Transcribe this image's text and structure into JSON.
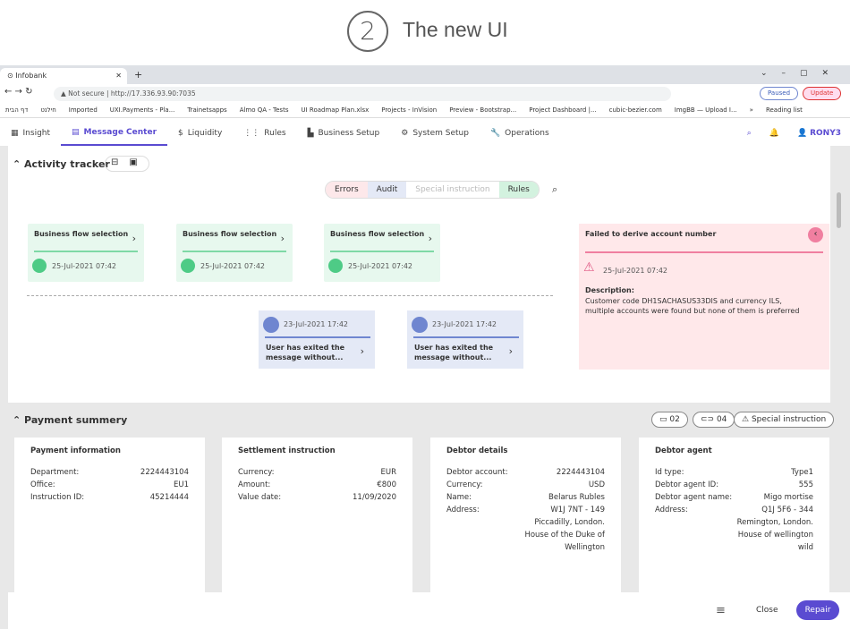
{
  "header": {
    "step": "2",
    "title": "The new UI"
  },
  "browser": {
    "tab_title": "Infobank",
    "security": "Not secure",
    "url": "http://17.336.93.90:7035",
    "paused": "Paused",
    "update": "Update",
    "bookmarks": [
      "דף הבית",
      "חילנט",
      "Imported",
      "UXI.Payments - Pla...",
      "Trainetsapps",
      "Almo QA - Tests",
      "UI Roadmap Plan.xlsx",
      "Projects - InVision",
      "Preview - Bootstrap...",
      "Project Dashboard |...",
      "cubic-bezier.com",
      "ImgBB — Upload I...",
      "»",
      "Reading list"
    ]
  },
  "nav": {
    "items": [
      "Insight",
      "Message Center",
      "Liquidity",
      "Rules",
      "Business Setup",
      "System Setup",
      "Operations"
    ],
    "active": "Message Center",
    "user": "RONY3"
  },
  "activity": {
    "title": "Activity tracker",
    "filters": [
      "Errors",
      "Audit",
      "Special instruction",
      "Rules"
    ],
    "flow_cards": [
      {
        "title": "Business flow selection",
        "date": "25-Jul-2021 07:42"
      },
      {
        "title": "Business flow selection",
        "date": "25-Jul-2021 07:42"
      },
      {
        "title": "Business flow selection",
        "date": "25-Jul-2021 07:42"
      }
    ],
    "audit_cards": [
      {
        "date": "23-Jul-2021 17:42",
        "title": "User has exited the message without..."
      },
      {
        "date": "23-Jul-2021 17:42",
        "title": "User has exited the message without..."
      }
    ],
    "error": {
      "title": "Failed to derive account number",
      "date": "25-Jul-2021 07:42",
      "desc_label": "Description:",
      "desc": "Customer code DH1SACHASUS33DIS and currency ILS, multiple accounts were found but none of them is preferred"
    }
  },
  "payment": {
    "title": "Payment summery",
    "comments": "02",
    "attachments": "04",
    "special": "Special instruction",
    "cards": [
      {
        "title": "Payment  information",
        "rows": [
          [
            "Department:",
            "2224443104"
          ],
          [
            "Office:",
            "EU1"
          ],
          [
            "Instruction ID:",
            "45214444"
          ]
        ]
      },
      {
        "title": "Settlement instruction",
        "rows": [
          [
            "Currency:",
            "EUR"
          ],
          [
            "Amount:",
            "€800"
          ],
          [
            "Value date:",
            "11/09/2020"
          ]
        ]
      },
      {
        "title": "Debtor details",
        "rows": [
          [
            "Debtor account:",
            "2224443104"
          ],
          [
            "Currency:",
            "USD"
          ],
          [
            "Name:",
            "Belarus Rubles"
          ],
          [
            "Address:",
            "W1J 7NT - 149"
          ],
          [
            "",
            "Piccadilly, London."
          ],
          [
            "",
            "House of the Duke of"
          ],
          [
            "",
            "Wellington"
          ]
        ]
      },
      {
        "title": "Debtor agent",
        "rows": [
          [
            "Id type:",
            "Type1"
          ],
          [
            "Debtor agent ID:",
            "555"
          ],
          [
            "Debtor agent name:",
            "Migo mortise"
          ],
          [
            "Address:",
            "Q1J 5F6 - 344"
          ],
          [
            "",
            "Remington, London."
          ],
          [
            "",
            "House of  wellington"
          ],
          [
            "",
            "wild"
          ]
        ]
      }
    ]
  },
  "footer": {
    "close": "Close",
    "repair": "Repair"
  },
  "colors": {
    "accent": "#5a4bd1",
    "flow": "#4ecb86",
    "audit": "#6f86d0",
    "error": "#f07fa0"
  }
}
